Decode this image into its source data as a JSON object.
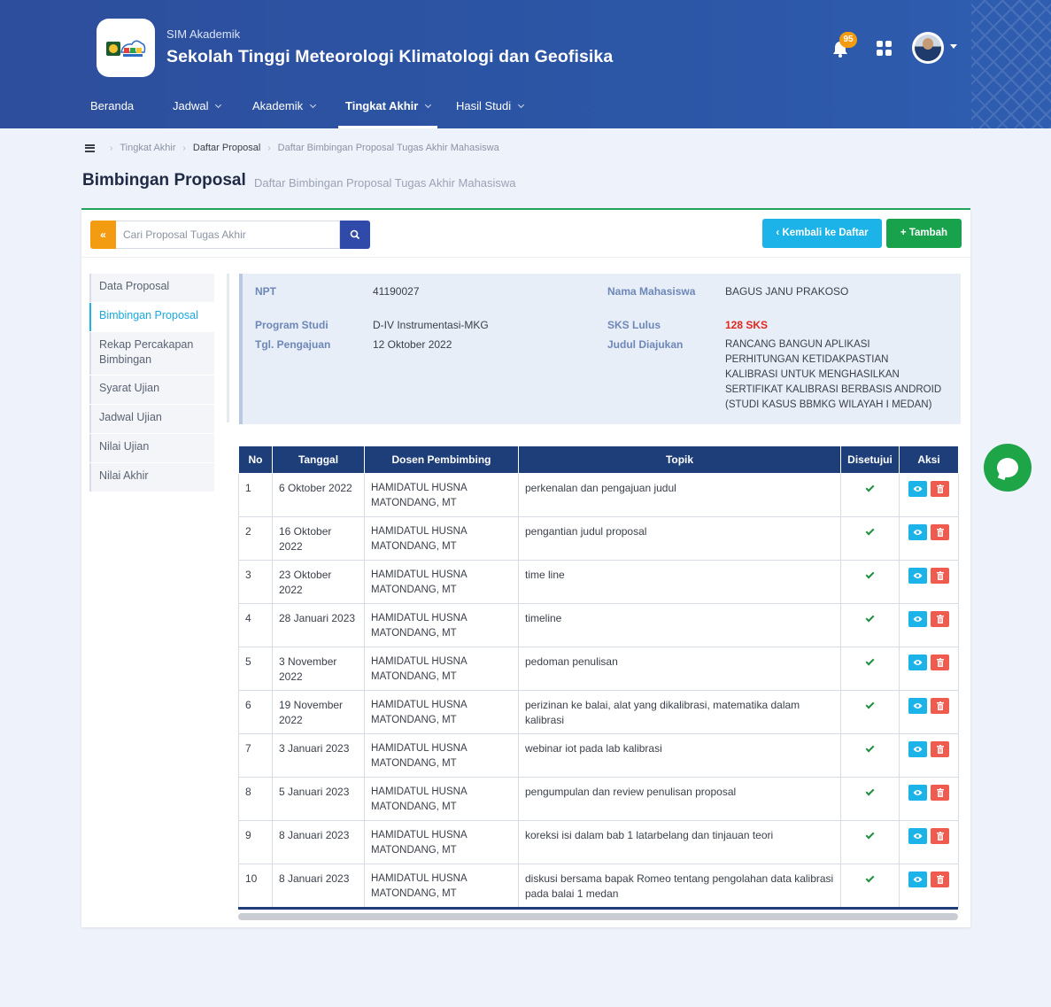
{
  "header": {
    "subtitle": "SIM Akademik",
    "title": "Sekolah Tinggi Meteorologi Klimatologi dan Geofisika",
    "notification_count": "95",
    "colors": {
      "header_bg": "#2d4e9c",
      "badge": "#f39c12",
      "accent_green": "#18a24c",
      "accent_cyan": "#1bb3e8"
    }
  },
  "nav": {
    "items": [
      {
        "label": "Beranda",
        "has_dropdown": false
      },
      {
        "label": "Jadwal",
        "has_dropdown": true
      },
      {
        "label": "Akademik",
        "has_dropdown": true
      },
      {
        "label": "Tingkat Akhir",
        "has_dropdown": true,
        "active": true
      },
      {
        "label": "Hasil Studi",
        "has_dropdown": true
      }
    ]
  },
  "breadcrumb": {
    "items": [
      "Tingkat Akhir",
      "Daftar Proposal",
      "Daftar Bimbingan Proposal Tugas Akhir Mahasiswa"
    ]
  },
  "page": {
    "title": "Bimbingan Proposal",
    "subtitle": "Daftar Bimbingan Proposal Tugas Akhir Mahasiswa"
  },
  "toolbar": {
    "collapse_label": "«",
    "search_placeholder": "Cari Proposal Tugas Akhir",
    "back_label": "Kembali ke Daftar",
    "add_label": "Tambah"
  },
  "side_menu": {
    "items": [
      "Data Proposal",
      "Bimbingan Proposal",
      "Rekap Percakapan Bimbingan",
      "Syarat Ujian",
      "Jadwal Ujian",
      "Nilai Ujian",
      "Nilai Akhir"
    ],
    "active": "Bimbingan Proposal"
  },
  "info": {
    "npt_label": "NPT",
    "npt": "41190027",
    "prodi_label": "Program Studi",
    "prodi": "D-IV Instrumentasi-MKG",
    "tgl_label": "Tgl. Pengajuan",
    "tgl": "12 Oktober 2022",
    "nama_label": "Nama Mahasiswa",
    "nama": "BAGUS JANU PRAKOSO",
    "sks_label": "SKS Lulus",
    "sks": "128 SKS",
    "judul_label": "Judul Diajukan",
    "judul": "RANCANG BANGUN APLIKASI PERHITUNGAN KETIDAKPASTIAN KALIBRASI UNTUK MENGHASILKAN SERTIFIKAT KALIBRASI BERBASIS ANDROID (STUDI KASUS BBMKG WILAYAH I MEDAN)"
  },
  "table": {
    "headers": [
      "No",
      "Tanggal",
      "Dosen Pembimbing",
      "Topik",
      "Disetujui",
      "Aksi"
    ],
    "rows": [
      {
        "no": "1",
        "tanggal": "6 Oktober 2022",
        "dosen": "HAMIDATUL HUSNA MATONDANG, MT",
        "topik": "perkenalan dan pengajuan judul",
        "disetujui": true
      },
      {
        "no": "2",
        "tanggal": "16 Oktober 2022",
        "dosen": "HAMIDATUL HUSNA MATONDANG, MT",
        "topik": "pengantian judul proposal",
        "disetujui": true
      },
      {
        "no": "3",
        "tanggal": "23 Oktober 2022",
        "dosen": "HAMIDATUL HUSNA MATONDANG, MT",
        "topik": "time line",
        "disetujui": true
      },
      {
        "no": "4",
        "tanggal": "28 Januari 2023",
        "dosen": "HAMIDATUL HUSNA MATONDANG, MT",
        "topik": "timeline",
        "disetujui": true
      },
      {
        "no": "5",
        "tanggal": "3 November 2022",
        "dosen": "HAMIDATUL HUSNA MATONDANG, MT",
        "topik": "pedoman penulisan",
        "disetujui": true
      },
      {
        "no": "6",
        "tanggal": "19 November 2022",
        "dosen": "HAMIDATUL HUSNA MATONDANG, MT",
        "topik": "perizinan ke balai, alat yang dikalibrasi, matematika dalam kalibrasi",
        "disetujui": true
      },
      {
        "no": "7",
        "tanggal": "3 Januari 2023",
        "dosen": "HAMIDATUL HUSNA MATONDANG, MT",
        "topik": "webinar iot pada lab kalibrasi",
        "disetujui": true
      },
      {
        "no": "8",
        "tanggal": "5 Januari 2023",
        "dosen": "HAMIDATUL HUSNA MATONDANG, MT",
        "topik": "pengumpulan dan review penulisan proposal",
        "disetujui": true
      },
      {
        "no": "9",
        "tanggal": "8 Januari 2023",
        "dosen": "HAMIDATUL HUSNA MATONDANG, MT",
        "topik": "koreksi isi dalam bab 1 latarbelang dan tinjauan teori",
        "disetujui": true
      },
      {
        "no": "10",
        "tanggal": "8 Januari 2023",
        "dosen": "HAMIDATUL HUSNA MATONDANG, MT",
        "topik": "diskusi bersama bapak Romeo tentang pengolahan data kalibrasi pada balai 1 medan",
        "disetujui": true
      }
    ]
  }
}
